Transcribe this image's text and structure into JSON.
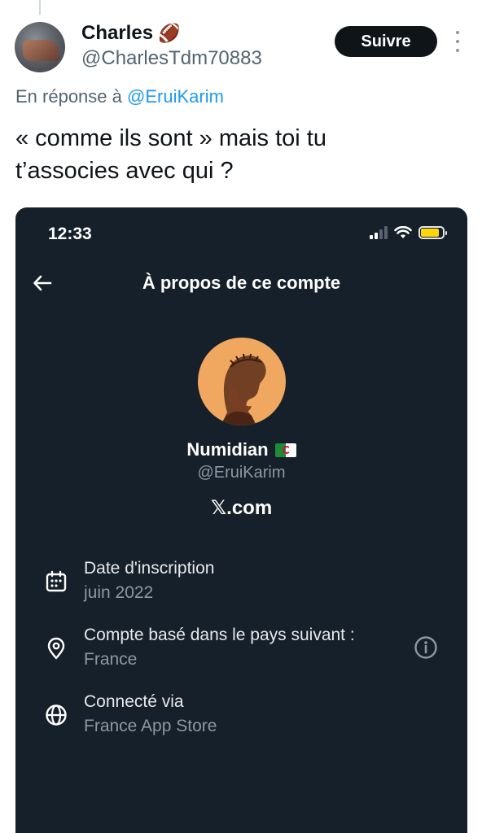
{
  "tweet": {
    "author_name": "Charles",
    "author_emoji": "🏈",
    "author_handle": "@CharlesTdm70883",
    "follow_label": "Suivre",
    "reply_prefix": "En réponse à",
    "reply_mention": "@EruiKarim",
    "text_line1": "« comme ils sont » mais toi tu",
    "text_line2": "t’associes avec qui ?"
  },
  "screenshot": {
    "clock": "12:33",
    "title": "À propos de ce compte",
    "display_name": "Numidian",
    "handle": "@EruiKarim",
    "platform": "𝕏.com",
    "battery_level": 0.85,
    "signal_bars_active": 2,
    "rows": [
      {
        "icon": "calendar-icon",
        "label": "Date d'inscription",
        "value": "juin 2022"
      },
      {
        "icon": "location-pin-icon",
        "label": "Compte basé dans le pays suivant :",
        "value": "France"
      },
      {
        "icon": "globe-icon",
        "label": "Connecté via",
        "value": "France App Store"
      }
    ]
  },
  "colors": {
    "follow_bg": "#0f1419",
    "mention": "#1d9bf0",
    "card_bg": "#16202a",
    "avatar_bg": "#f0a760",
    "battery": "#ffd60a"
  }
}
